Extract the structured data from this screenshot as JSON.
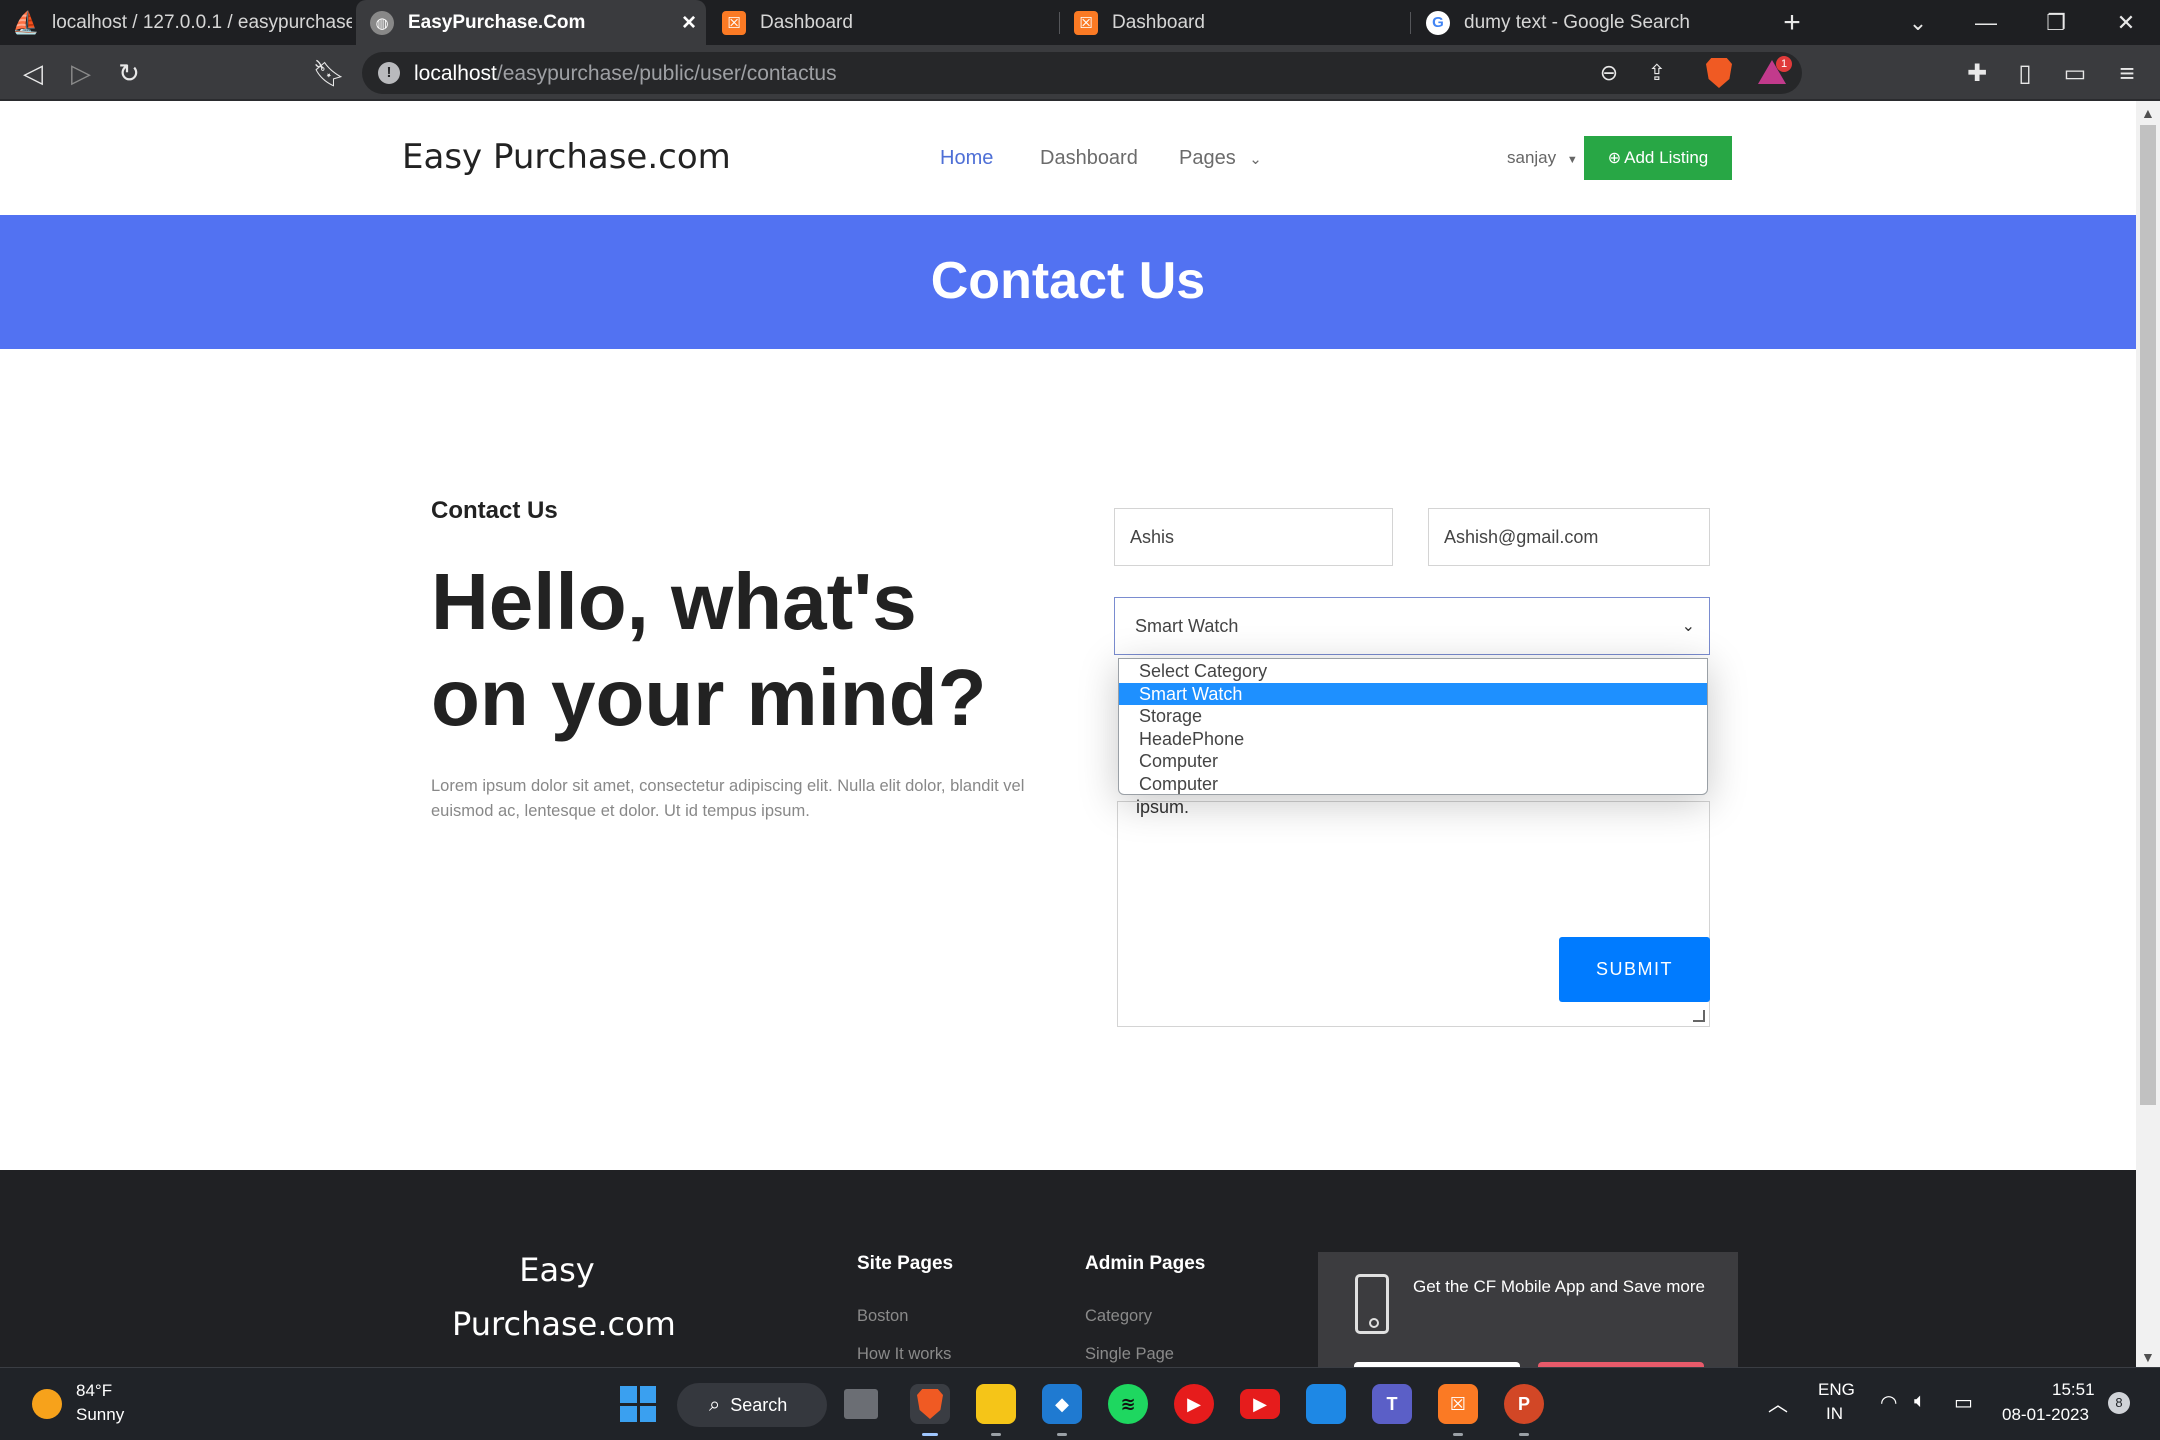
{
  "browser": {
    "tabs": [
      {
        "label": "localhost / 127.0.0.1 / easypurchase /",
        "favicon": "phpmyadmin-icon"
      },
      {
        "label": "EasyPurchase.Com",
        "favicon": "globe-icon",
        "active": true
      },
      {
        "label": "Dashboard",
        "favicon": "xampp-icon"
      },
      {
        "label": "Dashboard",
        "favicon": "xampp-icon"
      },
      {
        "label": "dumy text - Google Search",
        "favicon": "google-icon"
      }
    ],
    "url_host": "localhost",
    "url_path": "/easypurchase/public/user/contactus",
    "notification_count": "1"
  },
  "site": {
    "logo": "Easy Purchase.com",
    "nav": {
      "home": "Home",
      "dashboard": "Dashboard",
      "pages": "Pages"
    },
    "user": "sanjay",
    "add_listing": "Add Listing"
  },
  "hero": {
    "title": "Contact Us"
  },
  "contact": {
    "subtitle": "Contact Us",
    "headline": "Hello, what's on your mind?",
    "body": "Lorem ipsum dolor sit amet, consectetur adipiscing elit. Nulla elit dolor, blandit vel euismod ac, lentesque et dolor. Ut id tempus ipsum.",
    "name_value": "Ashis",
    "email_value": "Ashish@gmail.com",
    "category_value": "Smart Watch",
    "category_options": [
      "Select Category",
      "Smart Watch",
      "Storage",
      "HeadePhone",
      "Computer",
      "Computer"
    ],
    "message_visible": "ipsum.",
    "submit": "SUBMIT"
  },
  "footer": {
    "logo_line1": "Easy",
    "logo_line2": "Purchase.com",
    "site_pages": {
      "title": "Site Pages",
      "links": [
        "Boston",
        "How It works"
      ]
    },
    "admin_pages": {
      "title": "Admin Pages",
      "links": [
        "Category",
        "Single Page"
      ]
    },
    "app_text": "Get the CF Mobile App and Save more"
  },
  "taskbar": {
    "weather_temp": "84°F",
    "weather_desc": "Sunny",
    "search": "Search",
    "lang1": "ENG",
    "lang2": "IN",
    "time": "15:51",
    "date": "08-01-2023",
    "notif": "8"
  },
  "colors": {
    "accent": "#5272f2",
    "add_listing": "#28a745",
    "submit": "#007bff",
    "footer": "#202124"
  }
}
